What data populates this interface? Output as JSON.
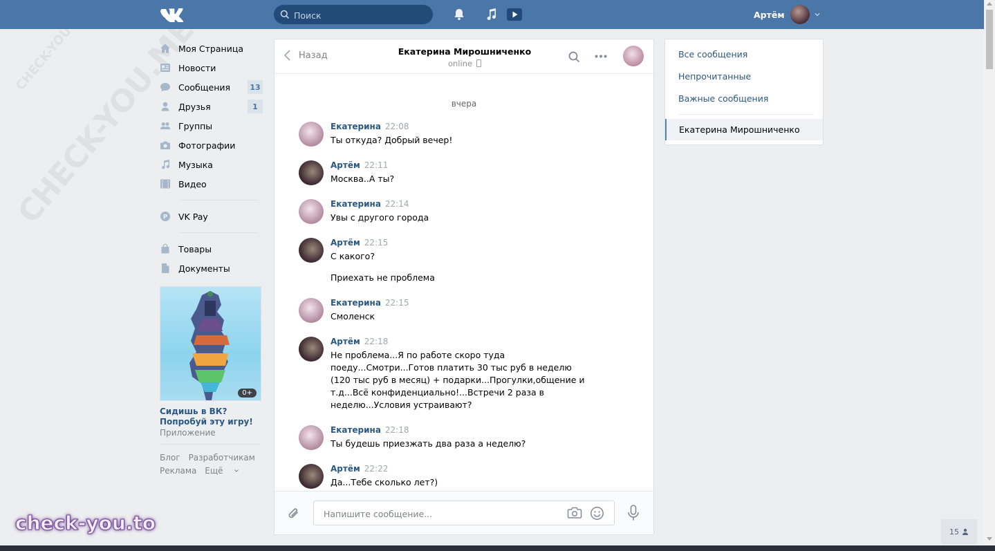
{
  "header": {
    "search_placeholder": "Поиск",
    "user_name": "Артём",
    "icons": [
      "vk-logo-icon",
      "search-icon",
      "bell-icon",
      "music-icon",
      "play-icon",
      "chevron-down-icon"
    ]
  },
  "sidebar": {
    "items": [
      {
        "label": "Моя Страница",
        "icon": "home-icon"
      },
      {
        "label": "Новости",
        "icon": "news-icon"
      },
      {
        "label": "Сообщения",
        "icon": "messages-icon",
        "badge": "13"
      },
      {
        "label": "Друзья",
        "icon": "user-icon",
        "badge": "1"
      },
      {
        "label": "Группы",
        "icon": "groups-icon"
      },
      {
        "label": "Фотографии",
        "icon": "camera-icon"
      },
      {
        "label": "Музыка",
        "icon": "music-icon"
      },
      {
        "label": "Видео",
        "icon": "video-icon"
      },
      {
        "label": "VK Pay",
        "icon": "vkpay-icon"
      },
      {
        "label": "Товары",
        "icon": "bag-icon"
      },
      {
        "label": "Документы",
        "icon": "document-icon"
      }
    ],
    "ad": {
      "age_badge": "0+",
      "title": "Сидишь в ВК? Попробуй эту игру!",
      "subtitle": "Приложение"
    },
    "footer": [
      "Блог",
      "Разработчикам",
      "Реклама",
      "Ещё"
    ]
  },
  "chat": {
    "back_label": "Назад",
    "title": "Екатерина Мирошниченко",
    "status": "online",
    "day_label": "вчера",
    "messages": [
      {
        "author": "Екатерина",
        "time": "22:08",
        "text": "Ты откуда? Добрый вечер!"
      },
      {
        "author": "Артём",
        "time": "22:11",
        "text": "Москва..А ты?"
      },
      {
        "author": "Екатерина",
        "time": "22:14",
        "text": "Увы с другого города"
      },
      {
        "author": "Артём",
        "time": "22:15",
        "text": "С какого?",
        "text2": "Приехать не проблема"
      },
      {
        "author": "Екатерина",
        "time": "22:15",
        "text": "Смоленск"
      },
      {
        "author": "Артём",
        "time": "22:18",
        "text": "Не проблема...Я по работе скоро туда поеду...Смотри...Готов платить 30 тыс руб в неделю (120 тыс руб в месяц) + подарки...Прогулки,общение и т.д...Всё конфиденциально!...Встречи 2 раза в неделю...Условия устраивают?"
      },
      {
        "author": "Екатерина",
        "time": "22:18",
        "text": "Ты будешь приезжать два раза а неделю?"
      },
      {
        "author": "Артём",
        "time": "22:22",
        "text": "Да...Тебе сколько лет?)"
      }
    ],
    "composer_placeholder": "Напишите сообщение..."
  },
  "right_menu": {
    "items": [
      "Все сообщения",
      "Непрочитанные",
      "Важные сообщения"
    ],
    "selected": "Екатерина Мирошниченко"
  },
  "online_count": "15",
  "watermark": {
    "brand": "check-you.to",
    "text": "CHECK-YOU.ME"
  },
  "colors": {
    "header": "#4a76a8",
    "link": "#2a5885",
    "background": "#edeef0"
  }
}
